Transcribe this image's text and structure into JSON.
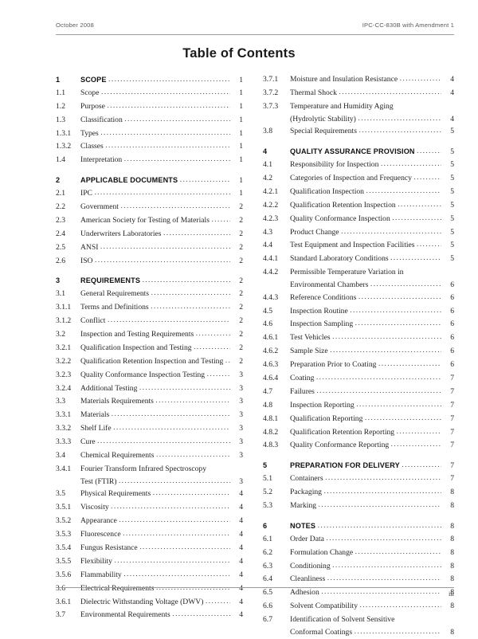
{
  "header": {
    "left": "October 2008",
    "right": "IPC-CC-830B with Amendment 1"
  },
  "title": "Table of Contents",
  "footer": {
    "page_number": "iii"
  },
  "columns": {
    "left": [
      {
        "num": "1",
        "title": "SCOPE",
        "page": "1",
        "major": true
      },
      {
        "num": "1.1",
        "title": "Scope",
        "page": "1"
      },
      {
        "num": "1.2",
        "title": "Purpose",
        "page": "1"
      },
      {
        "num": "1.3",
        "title": "Classification",
        "page": "1"
      },
      {
        "num": "1.3.1",
        "title": "Types",
        "page": "1"
      },
      {
        "num": "1.3.2",
        "title": "Classes",
        "page": "1"
      },
      {
        "num": "1.4",
        "title": "Interpretation",
        "page": "1"
      },
      {
        "num": "2",
        "title": "APPLICABLE DOCUMENTS",
        "page": "1",
        "major": true,
        "gap": true
      },
      {
        "num": "2.1",
        "title": "IPC",
        "page": "1"
      },
      {
        "num": "2.2",
        "title": "Government",
        "page": "2"
      },
      {
        "num": "2.3",
        "title": "American Society for Testing of Materials",
        "page": "2"
      },
      {
        "num": "2.4",
        "title": "Underwriters Laboratories",
        "page": "2"
      },
      {
        "num": "2.5",
        "title": "ANSI",
        "page": "2"
      },
      {
        "num": "2.6",
        "title": "ISO",
        "page": "2"
      },
      {
        "num": "3",
        "title": "REQUIREMENTS",
        "page": "2",
        "major": true,
        "gap": true
      },
      {
        "num": "3.1",
        "title": "General Requirements",
        "page": "2"
      },
      {
        "num": "3.1.1",
        "title": "Terms and Definitions",
        "page": "2"
      },
      {
        "num": "3.1.2",
        "title": "Conflict",
        "page": "2"
      },
      {
        "num": "3.2",
        "title": "Inspection and Testing Requirements",
        "page": "2"
      },
      {
        "num": "3.2.1",
        "title": "Qualification Inspection and Testing",
        "page": "2"
      },
      {
        "num": "3.2.2",
        "title": "Qualification Retention Inspection and Testing",
        "page": "2"
      },
      {
        "num": "3.2.3",
        "title": "Quality Conformance Inspection Testing",
        "page": "3"
      },
      {
        "num": "3.2.4",
        "title": "Additional Testing",
        "page": "3"
      },
      {
        "num": "3.3",
        "title": "Materials Requirements",
        "page": "3"
      },
      {
        "num": "3.3.1",
        "title": "Materials",
        "page": "3"
      },
      {
        "num": "3.3.2",
        "title": "Shelf Life",
        "page": "3"
      },
      {
        "num": "3.3.3",
        "title": "Cure",
        "page": "3"
      },
      {
        "num": "3.4",
        "title": "Chemical Requirements",
        "page": "3"
      },
      {
        "num": "3.4.1",
        "title": "Fourier Transform Infrared Spectroscopy",
        "title2": "Test (FTIR)",
        "page": "3"
      },
      {
        "num": "3.5",
        "title": "Physical Requirements",
        "page": "4"
      },
      {
        "num": "3.5.1",
        "title": "Viscosity",
        "page": "4"
      },
      {
        "num": "3.5.2",
        "title": "Appearance",
        "page": "4"
      },
      {
        "num": "3.5.3",
        "title": "Fluorescence",
        "page": "4"
      },
      {
        "num": "3.5.4",
        "title": "Fungus Resistance",
        "page": "4"
      },
      {
        "num": "3.5.5",
        "title": "Flexibility",
        "page": "4"
      },
      {
        "num": "3.5.6",
        "title": "Flammability",
        "page": "4"
      },
      {
        "num": "3.6",
        "title": "Electrical Requirements",
        "page": "4"
      },
      {
        "num": "3.6.1",
        "title": "Dielectric Withstanding Voltage (DWV)",
        "page": "4"
      },
      {
        "num": "3.7",
        "title": "Environmental Requirements",
        "page": "4"
      }
    ],
    "right": [
      {
        "num": "3.7.1",
        "title": "Moisture and Insulation Resistance",
        "page": "4"
      },
      {
        "num": "3.7.2",
        "title": "Thermal Shock",
        "page": "4"
      },
      {
        "num": "3.7.3",
        "title": "Temperature and Humidity Aging",
        "title2": "(Hydrolytic Stability)",
        "page": "4"
      },
      {
        "num": "3.8",
        "title": "Special Requirements",
        "page": "5"
      },
      {
        "num": "4",
        "title": "QUALITY ASSURANCE PROVISION",
        "page": "5",
        "major": true,
        "gap": true
      },
      {
        "num": "4.1",
        "title": "Responsibility for Inspection",
        "page": "5"
      },
      {
        "num": "4.2",
        "title": "Categories of Inspection and Frequency",
        "page": "5"
      },
      {
        "num": "4.2.1",
        "title": "Qualification Inspection",
        "page": "5"
      },
      {
        "num": "4.2.2",
        "title": "Qualification Retention Inspection",
        "page": "5"
      },
      {
        "num": "4.2.3",
        "title": "Quality Conformance Inspection",
        "page": "5"
      },
      {
        "num": "4.3",
        "title": "Product Change",
        "page": "5"
      },
      {
        "num": "4.4",
        "title": "Test Equipment and Inspection Facilities",
        "page": "5"
      },
      {
        "num": "4.4.1",
        "title": "Standard Laboratory Conditions",
        "page": "5"
      },
      {
        "num": "4.4.2",
        "title": "Permissible Temperature Variation in",
        "title2": "Environmental Chambers",
        "page": "6"
      },
      {
        "num": "4.4.3",
        "title": "Reference Conditions",
        "page": "6"
      },
      {
        "num": "4.5",
        "title": "Inspection Routine",
        "page": "6"
      },
      {
        "num": "4.6",
        "title": "Inspection Sampling",
        "page": "6"
      },
      {
        "num": "4.6.1",
        "title": "Test Vehicles",
        "page": "6"
      },
      {
        "num": "4.6.2",
        "title": "Sample Size",
        "page": "6"
      },
      {
        "num": "4.6.3",
        "title": "Preparation Prior to Coating",
        "page": "6"
      },
      {
        "num": "4.6.4",
        "title": "Coating",
        "page": "7"
      },
      {
        "num": "4.7",
        "title": "Failures",
        "page": "7"
      },
      {
        "num": "4.8",
        "title": "Inspection Reporting",
        "page": "7"
      },
      {
        "num": "4.8.1",
        "title": "Qualification Reporting",
        "page": "7"
      },
      {
        "num": "4.8.2",
        "title": "Qualification Retention Reporting",
        "page": "7"
      },
      {
        "num": "4.8.3",
        "title": "Quality Conformance Reporting",
        "page": "7"
      },
      {
        "num": "5",
        "title": "PREPARATION FOR DELIVERY",
        "page": "7",
        "major": true,
        "gap": true
      },
      {
        "num": "5.1",
        "title": "Containers",
        "page": "7"
      },
      {
        "num": "5.2",
        "title": "Packaging",
        "page": "8"
      },
      {
        "num": "5.3",
        "title": "Marking",
        "page": "8"
      },
      {
        "num": "6",
        "title": "NOTES",
        "page": "8",
        "major": true,
        "gap": true
      },
      {
        "num": "6.1",
        "title": "Order Data",
        "page": "8"
      },
      {
        "num": "6.2",
        "title": "Formulation Change",
        "page": "8"
      },
      {
        "num": "6.3",
        "title": "Conditioning",
        "page": "8"
      },
      {
        "num": "6.4",
        "title": "Cleanliness",
        "page": "8"
      },
      {
        "num": "6.5",
        "title": "Adhesion",
        "page": "8"
      },
      {
        "num": "6.6",
        "title": "Solvent Compatibility",
        "page": "8"
      },
      {
        "num": "6.7",
        "title": "Identification of Solvent Sensitive",
        "title2": "Conformal Coatings",
        "page": "8"
      }
    ]
  }
}
